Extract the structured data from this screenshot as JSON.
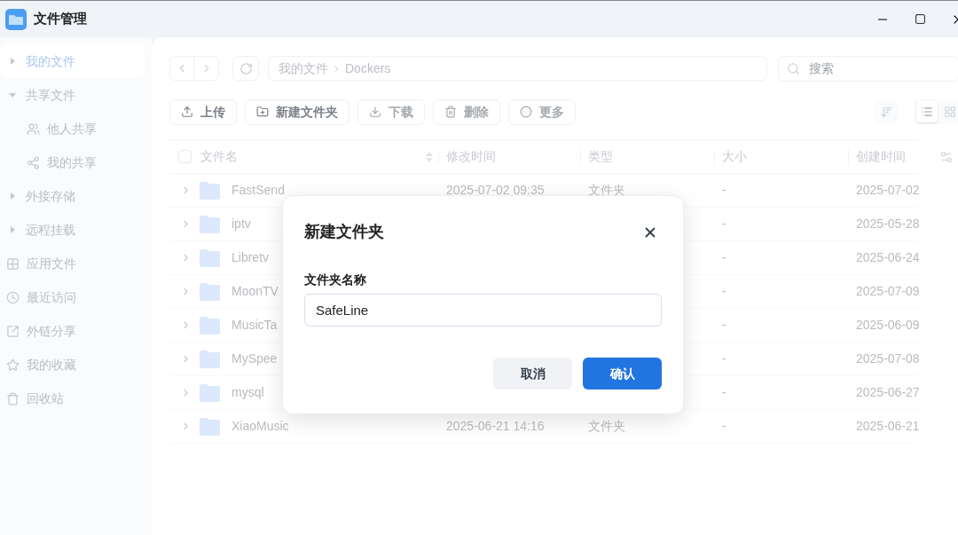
{
  "window": {
    "title": "文件管理"
  },
  "sidebar": {
    "items": [
      {
        "kind": "node",
        "label": "我的文件",
        "selected": true,
        "expanded": false
      },
      {
        "kind": "node",
        "label": "共享文件",
        "selected": false,
        "expanded": true,
        "children": [
          {
            "kind": "link",
            "label": "他人共享",
            "selected": false
          },
          {
            "kind": "link",
            "label": "我的共享",
            "selected": false
          }
        ]
      },
      {
        "kind": "node",
        "label": "外接存储",
        "selected": false,
        "expanded": false
      },
      {
        "kind": "node",
        "label": "远程挂载",
        "selected": false,
        "expanded": false
      },
      {
        "kind": "link",
        "label": "应用文件",
        "selected": false
      },
      {
        "kind": "link",
        "label": "最近访问",
        "selected": false
      },
      {
        "kind": "link",
        "label": "外链分享",
        "selected": false
      },
      {
        "kind": "link",
        "label": "我的收藏",
        "selected": false
      },
      {
        "kind": "link",
        "label": "回收站",
        "selected": false
      }
    ]
  },
  "breadcrumb": [
    "我的文件",
    "Dockers"
  ],
  "search": {
    "placeholder": "搜索"
  },
  "toolbar": [
    {
      "label": "上传",
      "disabled": false
    },
    {
      "label": "新建文件夹",
      "disabled": false
    },
    {
      "label": "下载",
      "disabled": true
    },
    {
      "label": "删除",
      "disabled": true
    },
    {
      "label": "更多",
      "disabled": true
    }
  ],
  "view_modes": [
    {
      "selected": true
    },
    {
      "selected": false
    }
  ],
  "table": {
    "select_all": {
      "checked": false
    },
    "columns": [
      "文件名",
      "修改时间",
      "类型",
      "大小",
      "创建时间"
    ],
    "rows": [
      {
        "name": "FastSend",
        "modified": "2025-07-02 09:35",
        "type": "文件夹",
        "size": "-",
        "created": "2025-07-02"
      },
      {
        "name": "iptv",
        "size": "-",
        "created": "2025-05-28"
      },
      {
        "name": "Libretv",
        "size": "-",
        "created": "2025-06-24"
      },
      {
        "name": "MoonTV",
        "size": "-",
        "created": "2025-07-09"
      },
      {
        "name": "MusicTa",
        "size": "-",
        "created": "2025-06-09"
      },
      {
        "name": "MySpee",
        "size": "-",
        "created": "2025-07-08"
      },
      {
        "name": "mysql",
        "size": "-",
        "created": "2025-06-27"
      },
      {
        "name": "XiaoMusic",
        "modified": "2025-06-21 14:16",
        "type": "文件夹",
        "size": "-",
        "created": "2025-06-21"
      }
    ]
  },
  "dialog": {
    "title": "新建文件夹",
    "field_label": "文件夹名称",
    "value": "SafeLine",
    "buttons": [
      {
        "kind": "secondary",
        "label": "取消"
      },
      {
        "kind": "primary",
        "label": "确认"
      }
    ]
  }
}
